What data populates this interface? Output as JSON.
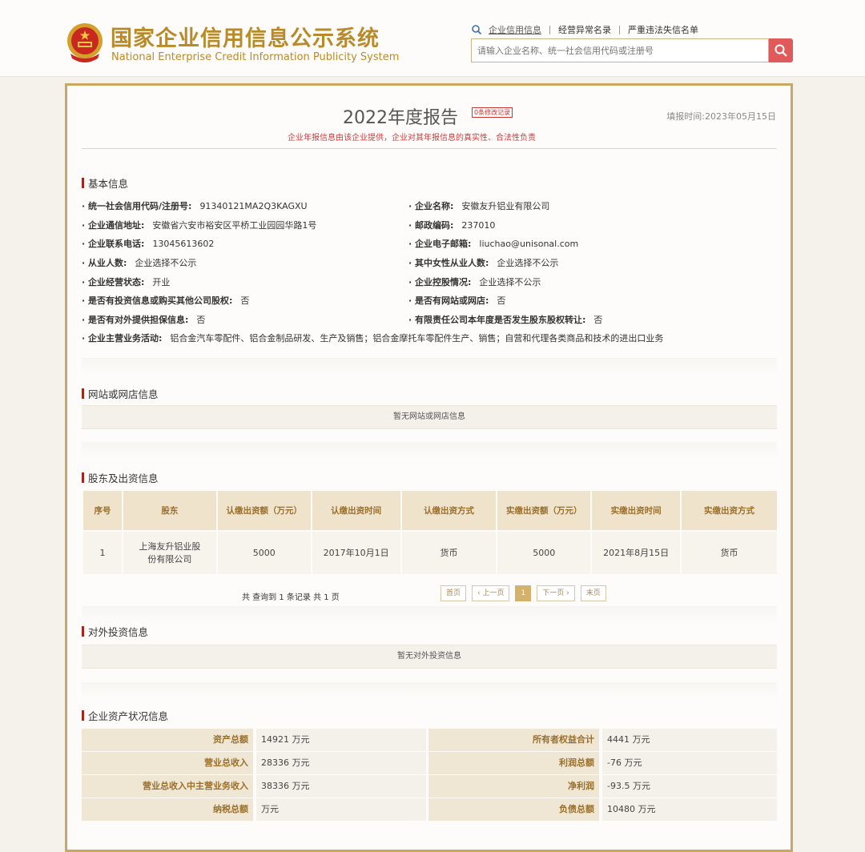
{
  "header": {
    "title_cn": "国家企业信用信息公示系统",
    "title_en": "National Enterprise Credit Information Publicity System",
    "links": [
      "企业信用信息",
      "经营异常名录",
      "严重违法失信名单"
    ],
    "search_placeholder": "请输入企业名称、统一社会信用代码或注册号"
  },
  "report": {
    "title": "2022年度报告",
    "mod_badge": "0条修改记录",
    "fill_time": "填报时间:2023年05月15日",
    "disclaimer": "企业年报信息由该企业提供，企业对其年报信息的真实性、合法性负责"
  },
  "basic": {
    "section_title": "基本信息",
    "left": [
      {
        "k": "· 统一社会信用代码/注册号:",
        "v": "91340121MA2Q3KAGXU"
      },
      {
        "k": "· 企业通信地址:",
        "v": "安徽省六安市裕安区平桥工业园园华路1号"
      },
      {
        "k": "· 企业联系电话:",
        "v": "13045613602"
      },
      {
        "k": "· 从业人数:",
        "v": "企业选择不公示"
      },
      {
        "k": "· 企业经营状态:",
        "v": "开业"
      },
      {
        "k": "· 是否有投资信息或购买其他公司股权:",
        "v": "否"
      },
      {
        "k": "· 是否有对外提供担保信息:",
        "v": "否"
      }
    ],
    "right": [
      {
        "k": "· 企业名称:",
        "v": "安徽友升铝业有限公司"
      },
      {
        "k": "· 邮政编码:",
        "v": "237010"
      },
      {
        "k": "· 企业电子邮箱:",
        "v": "liuchao@unisonal.com"
      },
      {
        "k": "· 其中女性从业人数:",
        "v": "企业选择不公示"
      },
      {
        "k": "· 企业控股情况:",
        "v": "企业选择不公示"
      },
      {
        "k": "· 是否有网站或网店:",
        "v": "否"
      },
      {
        "k": "· 有限责任公司本年度是否发生股东股权转让:",
        "v": "否"
      }
    ],
    "business": {
      "k": "· 企业主营业务活动:",
      "v": "铝合金汽车零配件、铝合金制品研发、生产及销售；铝合金摩托车零配件生产、销售；自营和代理各类商品和技术的进出口业务"
    }
  },
  "website": {
    "section_title": "网站或网店信息",
    "empty": "暂无网站或网店信息"
  },
  "shareholders": {
    "section_title": "股东及出资信息",
    "headers": [
      "序号",
      "股东",
      "认缴出资额（万元）",
      "认缴出资时间",
      "认缴出资方式",
      "实缴出资额（万元）",
      "实缴出资时间",
      "实缴出资方式"
    ],
    "rows": [
      [
        "1",
        "上海友升铝业股份有限公司",
        "5000",
        "2017年10月1日",
        "货币",
        "5000",
        "2021年8月15日",
        "货币"
      ]
    ],
    "page_info": "共 查询到 1 条记录 共 1 页",
    "pager": [
      "首页",
      "‹ 上一页",
      "1",
      "下一页 ›",
      "末页"
    ]
  },
  "investment": {
    "section_title": "对外投资信息",
    "empty": "暂无对外投资信息"
  },
  "assets": {
    "section_title": "企业资产状况信息",
    "left": [
      {
        "k": "资产总额",
        "v": "14921 万元"
      },
      {
        "k": "营业总收入",
        "v": "28336 万元"
      },
      {
        "k": "营业总收入中主营业务收入",
        "v": "38336 万元"
      },
      {
        "k": "纳税总额",
        "v": "万元"
      }
    ],
    "right": [
      {
        "k": "所有者权益合计",
        "v": "4441 万元"
      },
      {
        "k": "利润总额",
        "v": "-76 万元"
      },
      {
        "k": "净利润",
        "v": "-93.5 万元"
      },
      {
        "k": "负债总额",
        "v": "10480 万元"
      }
    ]
  },
  "colors": {
    "gold": "#b88a2a",
    "frame": "#caa861",
    "red": "#d0393b",
    "search_button": "#e15a5a"
  }
}
